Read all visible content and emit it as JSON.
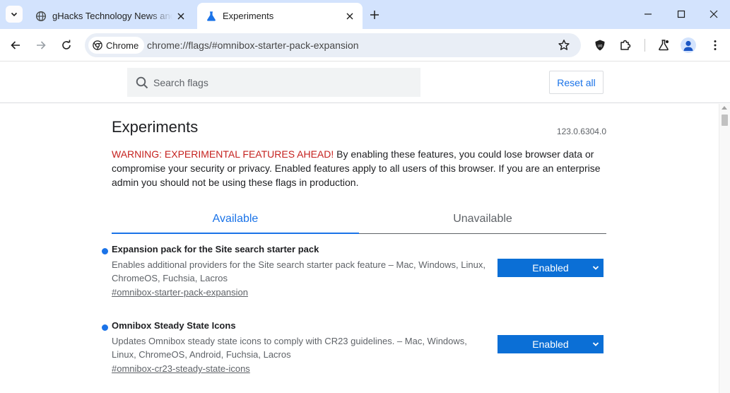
{
  "browser": {
    "tabs": [
      {
        "title": "gHacks Technology News and",
        "favicon": "globe-icon",
        "active": false
      },
      {
        "title": "Experiments",
        "favicon": "flask-icon",
        "active": true
      }
    ],
    "omnibox": {
      "chip_label": "Chrome",
      "url": "chrome://flags/#omnibox-starter-pack-expansion"
    }
  },
  "flags": {
    "search_placeholder": "Search flags",
    "reset_label": "Reset all",
    "title": "Experiments",
    "version": "123.0.6304.0",
    "warning_label": "WARNING: EXPERIMENTAL FEATURES AHEAD!",
    "warning_text": " By enabling these features, you could lose browser data or compromise your security or privacy. Enabled features apply to all users of this browser. If you are an enterprise admin you should not be using these flags in production.",
    "tabs": {
      "available": "Available",
      "unavailable": "Unavailable"
    },
    "experiments": [
      {
        "name": "Expansion pack for the Site search starter pack",
        "description": "Enables additional providers for the Site search starter pack feature – Mac, Windows, Linux, ChromeOS, Fuchsia, Lacros",
        "link": "#omnibox-starter-pack-expansion",
        "state": "Enabled"
      },
      {
        "name": "Omnibox Steady State Icons",
        "description": "Updates Omnibox steady state icons to comply with CR23 guidelines. – Mac, Windows, Linux, ChromeOS, Android, Fuchsia, Lacros",
        "link": "#omnibox-cr23-steady-state-icons",
        "state": "Enabled"
      }
    ]
  },
  "colors": {
    "tabstrip": "#d3e3fd",
    "accent": "#1a73e8",
    "warning": "#c5221f",
    "select_bg": "#0b6fd6"
  }
}
